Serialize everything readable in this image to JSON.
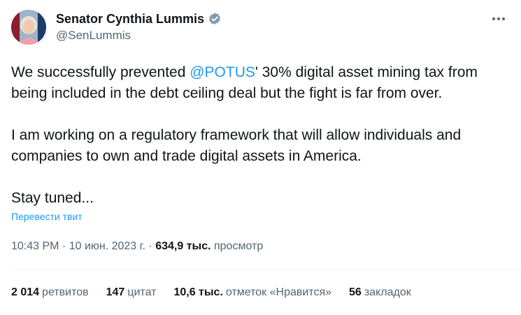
{
  "author": {
    "name": "Senator Cynthia Lummis",
    "handle": "@SenLummis",
    "verified": true,
    "verified_color": "#829aab"
  },
  "tweet": {
    "p1_before": "We successfully prevented ",
    "mention": "@POTUS",
    "p1_after": "' 30% digital asset mining tax from being included in the debt ceiling deal but the fight is far from over.",
    "p2": "I am working on a regulatory framework that will allow individuals and companies to own and trade digital assets in America.",
    "p3": "Stay tuned..."
  },
  "translate_link": "Перевести твит",
  "meta": {
    "time": "10:43 PM",
    "sep1": " · ",
    "date": "10 июн. 2023 г.",
    "sep2": " · ",
    "views_count": "634,9 тыс.",
    "views_label": " просмотр"
  },
  "stats": [
    {
      "count": "2 014",
      "label": "ретвитов"
    },
    {
      "count": "147",
      "label": "цитат"
    },
    {
      "count": "10,6 тыс.",
      "label": "отметок «Нравится»"
    },
    {
      "count": "56",
      "label": "закладок"
    }
  ],
  "colors": {
    "accent": "#1d9bf0",
    "text": "#0f1419",
    "secondary": "#536471"
  },
  "icons": {
    "avatar": "profile-photo",
    "verified": "verified-badge-icon",
    "more": "more-options-icon"
  }
}
